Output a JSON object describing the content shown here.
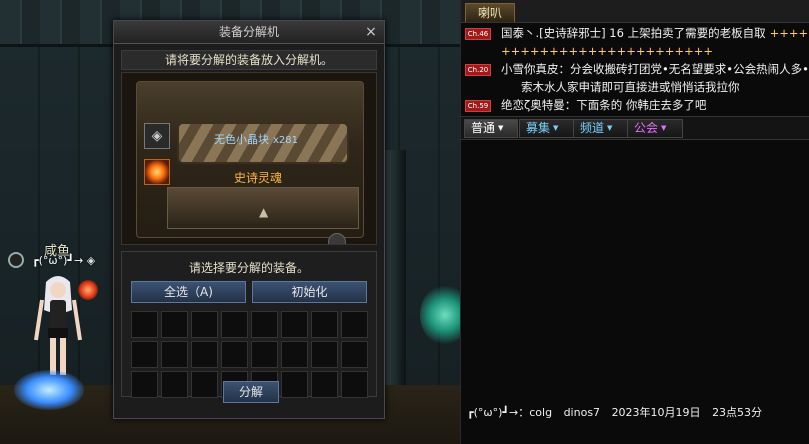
{
  "window": {
    "title": "装备分解机",
    "close_glyph": "×",
    "hint_top": "请将要分解的装备放入分解机。",
    "crystal_label": "无色小晶块",
    "crystal_count": "x281",
    "soul_label": "史诗灵魂",
    "hint_select": "请选择要分解的装备。",
    "select_all_label": "全选（A)",
    "reset_label": "初始化",
    "decompose_label": "分解"
  },
  "character": {
    "name": "咸鱼",
    "title": "┏(°ω°)┛→"
  },
  "chat": {
    "horn_tab": "喇叭",
    "messages": [
      {
        "channel": "Ch.46",
        "text": "国泰丶.[史诗辞邪士] 16 上架拍卖了需要的老板自取",
        "tail": "++++",
        "cont": "++++++++++++++++++++++"
      },
      {
        "channel": "Ch.20",
        "text": "小雪你真皮：分会收搬砖打团党•无名望要求•公会热闹人多•",
        "cont": "索木水人家申请即可直接进或悄悄话我拉你"
      },
      {
        "channel": "Ch.59",
        "text": "绝恋ζ奥特曼：下面条的 你韩庄去多了吧"
      }
    ],
    "tabs": {
      "normal": "普通",
      "recruit": "募集",
      "channel": "频道",
      "guild": "公会"
    },
    "tab_arrow": "▼",
    "log": {
      "text": "┏(°ω°)┛→：colg",
      "name": "dinos7",
      "date": "2023年10月19日",
      "time": "23点53分"
    }
  },
  "colors": {
    "window_bg": "#1c1c1c",
    "button_blue": "#3c5272",
    "soul_orange": "#ffb640",
    "crystal_blue": "#9fd6ff",
    "channel_badge_red": "#a01a1a",
    "recruit_tab_color": "#7ad0ff",
    "guild_tab_color": "#e070ff"
  },
  "icons": {
    "cube": "cube-icon",
    "soul": "epic-soul-icon",
    "arrow": "up-arrow-icon"
  }
}
